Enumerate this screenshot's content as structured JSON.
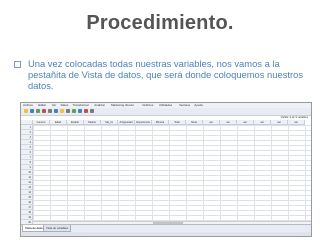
{
  "slide": {
    "title": "Procedimiento.",
    "bullet": "Una vez colocadas todas nuestras variables, nos vamos a la pestañita de Vista de datos, que será donde coloquemos nuestros datos."
  },
  "spss": {
    "menu": [
      "Archivo",
      "Editar",
      "Ver",
      "Datos",
      "Transformar",
      "Analizar",
      "Marketing directo",
      "Gráficos",
      "Utilidades",
      "Ventana",
      "Ayuda"
    ],
    "visible_info": "Visible: 9 de 9 variables",
    "columns": [
      "Genero",
      "Edad",
      "Estado",
      "Salario",
      "Sal_ini",
      "Antiguedad",
      "Experiencia",
      "Minoria",
      "Todo",
      "Nivel",
      "var",
      "var",
      "var",
      "var",
      "var",
      "var"
    ],
    "rows": [
      "1",
      "2",
      "3",
      "4",
      "5",
      "6",
      "7",
      "8",
      "9",
      "10",
      "11",
      "12",
      "13",
      "14",
      "15",
      "16",
      "17",
      "18",
      "19",
      "20"
    ],
    "tabs": {
      "data_view": "Vista de datos",
      "variable_view": "Vista de variables"
    }
  }
}
